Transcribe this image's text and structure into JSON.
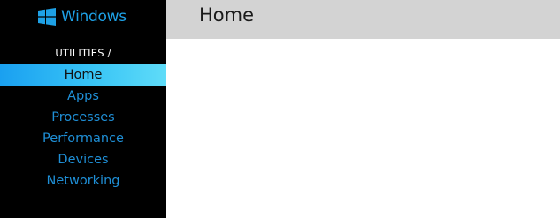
{
  "brand": {
    "name": "Windows",
    "icon": "windows-logo-icon",
    "color": "#1ea1e6"
  },
  "sidebar": {
    "section_header": "UTILITIES /",
    "items": [
      {
        "label": "Home",
        "active": true
      },
      {
        "label": "Apps",
        "active": false
      },
      {
        "label": "Processes",
        "active": false
      },
      {
        "label": "Performance",
        "active": false
      },
      {
        "label": "Devices",
        "active": false
      },
      {
        "label": "Networking",
        "active": false
      }
    ]
  },
  "header": {
    "title": "Home"
  },
  "colors": {
    "sidebar_bg": "#000000",
    "nav_text": "#1f8fd6",
    "active_gradient_start": "#1aa0f0",
    "active_gradient_end": "#5fdcf8",
    "header_bg": "#d3d3d3"
  }
}
